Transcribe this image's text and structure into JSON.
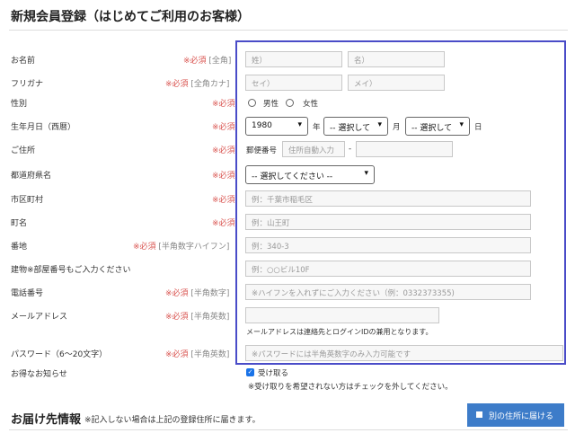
{
  "page": {
    "title": "新規会員登録（はじめてご利用のお客様）"
  },
  "form": {
    "name": {
      "label": "お名前",
      "required": "※必須",
      "hint": "[全角]",
      "last_placeholder": "姓）",
      "first_placeholder": "名）"
    },
    "kana": {
      "label": "フリガナ",
      "required": "※必須",
      "hint": "[全角カナ]",
      "last_placeholder": "セイ）",
      "first_placeholder": "メイ）"
    },
    "gender": {
      "label": "性別",
      "required": "※必須",
      "male": "男性",
      "female": "女性"
    },
    "birth": {
      "label": "生年月日（西暦）",
      "required": "※必須",
      "year_value": "1980",
      "year_unit": "年",
      "month_value": "-- 選択して",
      "month_unit": "月",
      "day_value": "-- 選択して",
      "day_unit": "日"
    },
    "address": {
      "label": "ご住所",
      "required": "※必須",
      "zip_label": "郵便番号",
      "zip1_placeholder": "住所自動入力",
      "dash": "-"
    },
    "prefecture": {
      "label": "都道府県名",
      "required": "※必須",
      "selected": "-- 選択してください --"
    },
    "city": {
      "label": "市区町村",
      "required": "※必須",
      "placeholder": "例：千葉市稲毛区"
    },
    "town": {
      "label": "町名",
      "required": "※必須",
      "placeholder": "例：山王町"
    },
    "street": {
      "label": "番地",
      "required": "※必須",
      "hint": "[半角数字ハイフン]",
      "placeholder": "例：340-3"
    },
    "building": {
      "label": "建物※部屋番号もご入力ください",
      "placeholder": "例：○○ビル10F"
    },
    "phone": {
      "label": "電話番号",
      "required": "※必須",
      "hint": "[半角数字]",
      "placeholder": "※ハイフンを入れずにご入力ください（例：0332373355)"
    },
    "email": {
      "label": "メールアドレス",
      "required": "※必須",
      "hint": "[半角英数]",
      "note": "メールアドレスは連絡先とログインIDの兼用となります。"
    },
    "password": {
      "label": "パスワード（6～20文字）",
      "required": "※必須",
      "hint": "[半角英数]",
      "placeholder": "※パスワードには半角英数字のみ入力可能です"
    },
    "newsletter": {
      "label": "お得なお知らせ",
      "checkbox_label": "受け取る",
      "check_mark": "✓",
      "note": "※受け取りを希望されない方はチェックを外してください。"
    }
  },
  "delivery": {
    "title": "お届け先情報",
    "note": "※記入しない場合は上記の登録住所に届きます。",
    "button_label": "別の住所に届ける"
  },
  "colors": {
    "highlight": "#4a4cc8",
    "required": "#d9534f",
    "button": "#3d7cc9",
    "checkbox": "#1a73e8"
  },
  "icons": {
    "select_chevron": "▾"
  }
}
